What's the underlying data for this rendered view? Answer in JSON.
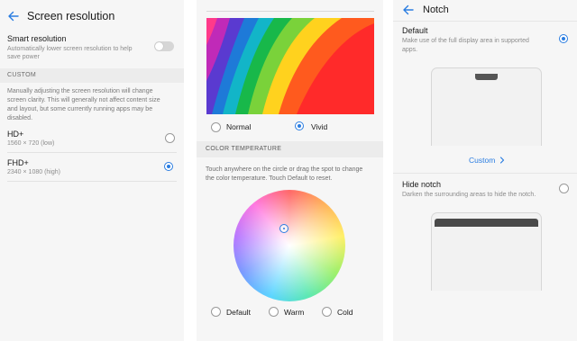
{
  "resolution_panel": {
    "title": "Screen resolution",
    "smart": {
      "title": "Smart resolution",
      "description_line1": "Automatically lower screen resolution to help",
      "description_line2": "save power",
      "enabled": false
    },
    "custom_section": "CUSTOM",
    "custom_description_line1": "Manually adjusting the screen resolution will change",
    "custom_description_line2": "screen clarity. This will generally not affect content size",
    "custom_description_line3": "and layout, but some currently running apps may be",
    "custom_description_line4": "disabled.",
    "options": [
      {
        "label": "HD+",
        "value": "1560 × 720 (low)",
        "selected": false
      },
      {
        "label": "FHD+",
        "value": "2340 × 1080 (high)",
        "selected": true
      }
    ]
  },
  "color_panel": {
    "modes": [
      {
        "label": "Normal",
        "selected": false
      },
      {
        "label": "Vivid",
        "selected": true
      }
    ],
    "temperature_section": "COLOR TEMPERATURE",
    "temperature_hint_line1": "Touch anywhere on the circle or drag the spot to change",
    "temperature_hint_line2": "the color temperature. Touch Default to reset.",
    "temperature_options": [
      {
        "label": "Default",
        "selected": false
      },
      {
        "label": "Warm",
        "selected": false
      },
      {
        "label": "Cold",
        "selected": false
      }
    ]
  },
  "notch_panel": {
    "title": "Notch",
    "default_option": {
      "title": "Default",
      "description_line1": "Make use of the full display area in supported",
      "description_line2": "apps.",
      "selected": true
    },
    "custom_link": "Custom",
    "hide_option": {
      "title": "Hide notch",
      "description": "Darken the surrounding areas to hide the notch.",
      "selected": false
    }
  },
  "colors": {
    "accent": "#2a7de1",
    "panel_background": "#f6f6f6",
    "section_background": "#ececec"
  },
  "icons": [
    "back-arrow-icon",
    "chevron-right-icon"
  ]
}
